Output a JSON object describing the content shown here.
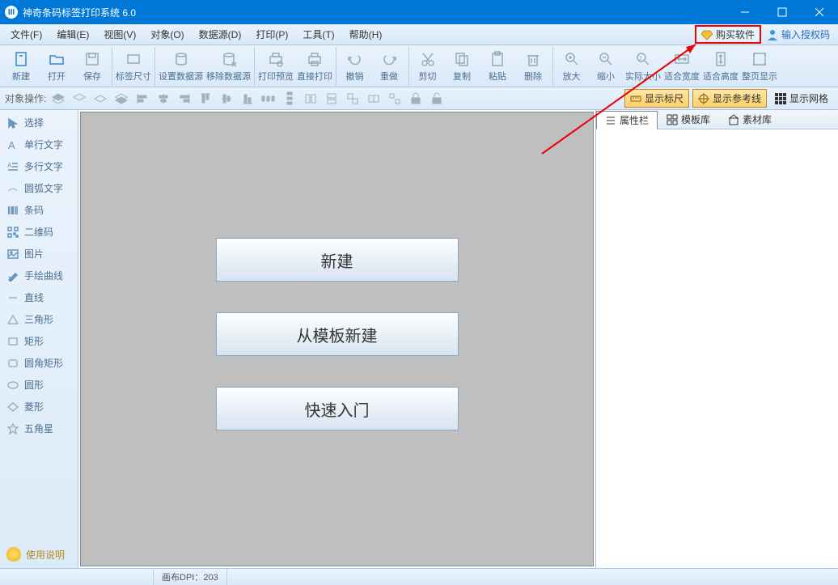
{
  "title": "神奇条码标签打印系统 6.0",
  "menu": {
    "file": "文件(F)",
    "edit": "编辑(E)",
    "view": "视图(V)",
    "object": "对象(O)",
    "datasource": "数据源(D)",
    "print": "打印(P)",
    "tool": "工具(T)",
    "help": "帮助(H)"
  },
  "menuRight": {
    "buy": "购买软件",
    "auth": "输入授权码"
  },
  "toolbar": {
    "new": "新建",
    "open": "打开",
    "save": "保存",
    "labelsize": "标签尺寸",
    "setds": "设置数据源",
    "rmds": "移除数据源",
    "preview": "打印预览",
    "print": "直接打印",
    "undo": "撤销",
    "redo": "重做",
    "cut": "剪切",
    "copy": "复制",
    "paste": "粘贴",
    "delete": "删除",
    "zoomin": "放大",
    "zoomout": "缩小",
    "actual": "实际大小",
    "fitw": "适合宽度",
    "fith": "适合高度",
    "whole": "整页显示"
  },
  "opbar": {
    "label": "对象操作:",
    "ruler": "显示标尺",
    "guide": "显示参考线",
    "grid": "显示网格"
  },
  "sidebar": {
    "select": "选择",
    "single": "单行文字",
    "multi": "多行文字",
    "arc": "圆弧文字",
    "barcode": "条码",
    "qr": "二维码",
    "image": "图片",
    "curve": "手绘曲线",
    "line": "直线",
    "triangle": "三角形",
    "rect": "矩形",
    "roundrect": "圆角矩形",
    "circle": "圆形",
    "diamond": "菱形",
    "star": "五角星",
    "help": "使用说明"
  },
  "canvas": {
    "new": "新建",
    "fromtpl": "从模板新建",
    "quick": "快速入门"
  },
  "tabs": {
    "prop": "属性栏",
    "tpl": "模板库",
    "asset": "素材库"
  },
  "status": {
    "dpi": "画布DPI：203"
  }
}
